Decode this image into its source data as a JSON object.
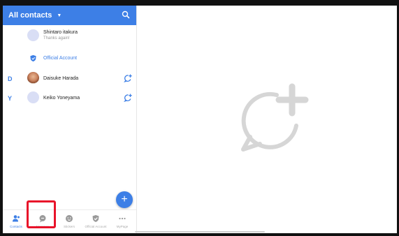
{
  "header": {
    "title": "All contacts",
    "caret_icon": "caret-down-icon",
    "search_icon": "search-icon",
    "background": "#3d7fe6"
  },
  "contacts": {
    "pinned": {
      "name": "Shintaro itakura",
      "status": "Thanks again!"
    },
    "official": {
      "label": "Official Account",
      "icon": "shield-icon"
    },
    "sections": [
      {
        "letter": "D",
        "name": "Daisuke Harada",
        "action_icon": "add-chat-icon"
      },
      {
        "letter": "Y",
        "name": "Keiko Yoneyama",
        "action_icon": "add-chat-icon"
      }
    ]
  },
  "fab": {
    "label": "+",
    "icon": "plus-icon"
  },
  "bottom_nav": {
    "items": [
      {
        "label": "Contacts",
        "icon": "contacts-icon",
        "active": true
      },
      {
        "label": "Message",
        "icon": "chat-bubble-icon",
        "active": false
      },
      {
        "label": "Stickers",
        "icon": "sticker-icon",
        "active": false
      },
      {
        "label": "Official Account",
        "icon": "shield-icon",
        "active": false
      },
      {
        "label": "MyPage",
        "icon": "more-icon",
        "active": false
      }
    ],
    "highlighted": "Message",
    "highlight_color": "#e8132a"
  },
  "right_panel": {
    "placeholder_icon": "new-chat-icon"
  },
  "colors": {
    "accent": "#3d7fe6",
    "muted": "#aaaaaa"
  }
}
